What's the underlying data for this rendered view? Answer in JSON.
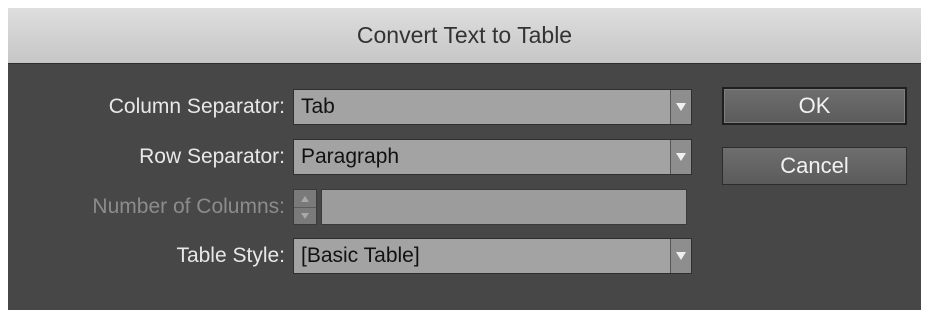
{
  "dialog": {
    "title": "Convert Text to Table"
  },
  "fields": {
    "column_separator": {
      "label": "Column Separator:",
      "value": "Tab"
    },
    "row_separator": {
      "label": "Row Separator:",
      "value": "Paragraph"
    },
    "number_of_columns": {
      "label": "Number of Columns:",
      "value": "",
      "enabled": false
    },
    "table_style": {
      "label": "Table Style:",
      "value": "[Basic Table]"
    }
  },
  "buttons": {
    "ok": "OK",
    "cancel": "Cancel"
  },
  "colors": {
    "dialog_bg": "#474747",
    "titlebar_bg": "#d2d2d2",
    "field_bg": "#a3a3a3",
    "label_text": "#e8e8e8",
    "disabled_label_text": "#8c8c8c"
  }
}
